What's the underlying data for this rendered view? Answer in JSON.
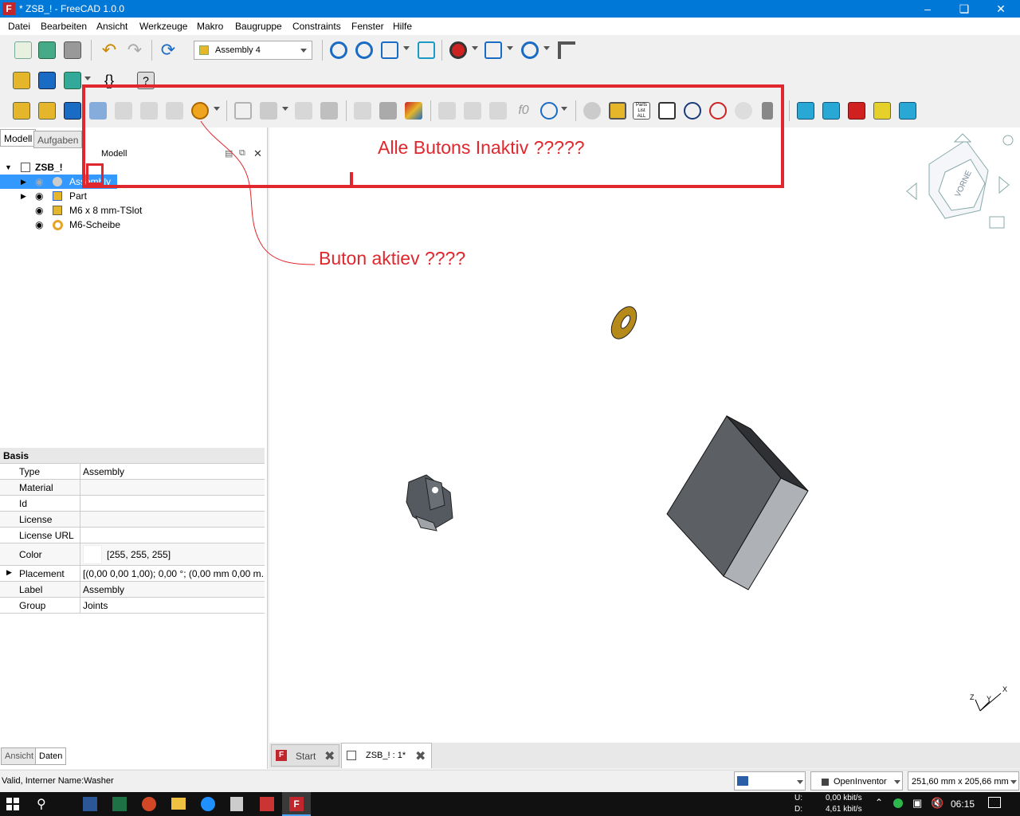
{
  "window": {
    "title": "* ZSB_! - FreeCAD 1.0.0",
    "app_icon": "freecad-logo"
  },
  "menu": [
    "Datei",
    "Bearbeiten",
    "Ansicht",
    "Werkzeuge",
    "Makro",
    "Baugruppe",
    "Constraints",
    "Fenster",
    "Hilfe"
  ],
  "workbench": {
    "selected": "Assembly 4"
  },
  "panel": {
    "tabs": [
      "Modell",
      "Aufgaben"
    ],
    "title": "Modell"
  },
  "tree": [
    {
      "label": "ZSB_!",
      "icon": "document-icon"
    },
    {
      "label": "Assembly",
      "icon": "assembly-icon",
      "selected": true
    },
    {
      "label": "Part",
      "icon": "part-icon"
    },
    {
      "label": "M6 x 8 mm-TSlot",
      "icon": "body-icon"
    },
    {
      "label": "M6-Scheibe",
      "icon": "washer-icon"
    }
  ],
  "properties": {
    "group": "Basis",
    "rows": [
      {
        "k": "Type",
        "v": "Assembly"
      },
      {
        "k": "Material",
        "v": ""
      },
      {
        "k": "Id",
        "v": ""
      },
      {
        "k": "License",
        "v": ""
      },
      {
        "k": "License URL",
        "v": ""
      },
      {
        "k": "Color",
        "v": "[255, 255, 255]"
      },
      {
        "k": "Placement",
        "v": "[(0,00 0,00 1,00); 0,00 °; (0,00 mm  0,00 m..."
      },
      {
        "k": "Label",
        "v": "Assembly"
      },
      {
        "k": "Group",
        "v": "Joints"
      }
    ],
    "bottom_tabs": [
      "Ansicht",
      "Daten"
    ]
  },
  "annotations": {
    "toolbar_note": "Alle Butons Inaktiv ?????",
    "button_note": "Buton aktiev ????"
  },
  "nav_cube": {
    "face": "VORNE"
  },
  "doc_tabs": [
    {
      "label": "Start"
    },
    {
      "label": "ZSB_! : 1*"
    }
  ],
  "status": {
    "message": "Valid, Interner Name:Washer",
    "navigation": "OpenInventor",
    "dimensions": "251,60 mm x 205,66 mm"
  },
  "taskbar": {
    "net_up_label": "U:",
    "net_down_label": "D:",
    "net_up": "0,00 kbit/s",
    "net_down": "4,61 kbit/s",
    "time": "06:15"
  }
}
